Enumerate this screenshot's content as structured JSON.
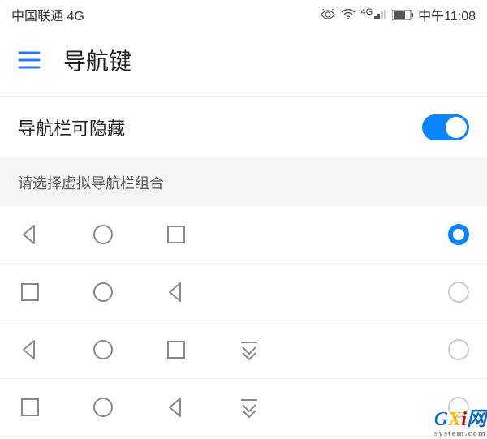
{
  "status": {
    "carrier": "中国联通 4G",
    "time_label": "中午11:08",
    "signal_4g": "4G"
  },
  "header": {
    "title": "导航键"
  },
  "toggle_row": {
    "label": "导航栏可隐藏",
    "value": true
  },
  "section": {
    "title": "请选择虚拟导航栏组合"
  },
  "options": [
    {
      "icons": [
        "back",
        "circle",
        "square"
      ],
      "selected": true
    },
    {
      "icons": [
        "square",
        "circle",
        "back"
      ],
      "selected": false
    },
    {
      "icons": [
        "back",
        "circle",
        "square",
        "dropdown"
      ],
      "selected": false
    },
    {
      "icons": [
        "square",
        "circle",
        "back",
        "dropdown"
      ],
      "selected": false
    }
  ],
  "watermark": {
    "text": "GXi",
    "sub": "system.com",
    "suffix": "网"
  },
  "colors": {
    "accent": "#0a84ff",
    "icon": "#888888"
  }
}
